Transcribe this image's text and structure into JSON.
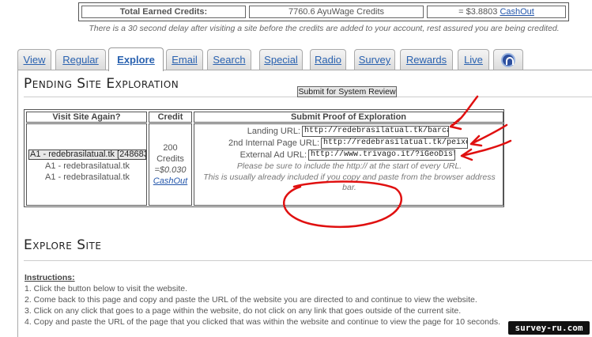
{
  "credits": {
    "label": "Total Earned Credits:",
    "amount": "7760.6 AyuWage Credits",
    "cash_prefix": "= $3.8803 ",
    "cashout_link": "CashOut"
  },
  "delay_note": "There is a 30 second delay after visiting a site before the credits are added to your account, rest assured you are being credited.",
  "tabs": [
    {
      "label": "View"
    },
    {
      "label": "Regular"
    },
    {
      "label": "Explore",
      "active": true
    },
    {
      "label": "Email"
    },
    {
      "label": "Search"
    },
    {
      "label": "Special"
    },
    {
      "label": "Radio"
    },
    {
      "label": "Survey"
    },
    {
      "label": "Rewards"
    },
    {
      "label": "Live"
    },
    {
      "label": "",
      "icon": "faq-icon"
    }
  ],
  "pending": {
    "title": "Pending Site Exploration",
    "headers": {
      "visit": "Visit Site Again?",
      "credit": "Credit",
      "proof": "Submit Proof of Exploration"
    },
    "visit_options": {
      "selected": "A1 - redebrasilatual.tk [248683]",
      "items": [
        "A1 - redebrasilatual.tk",
        "A1 - redebrasilatual.tk"
      ]
    },
    "credit": {
      "amount": "200",
      "unit": "Credits",
      "value": "=$0.030",
      "cashout_link": "CashOut"
    },
    "fields": {
      "landing_label": "Landing URL:",
      "landing_value": "http://redebrasilatual.tk/barca-de-berim",
      "internal_label": "2nd Internal Page URL:",
      "internal_value": "http://redebrasilatual.tk/peixe-na-folha",
      "external_label": "External Ad URL:",
      "external_value": "http://www.trivago.it/?iGeoDistanceItem"
    },
    "note1": "Please be sure to include the http:// at the start of every URL.",
    "note2": "This is usually already included if you copy and paste from the browser address bar.",
    "submit_label": "Submit for System Review"
  },
  "explore": {
    "title": "Explore Site",
    "instructions_title": "Instructions:",
    "steps": [
      "1. Click the button below to visit the website.",
      "2. Come back to this page and copy and paste the URL of the website you are directed to and continue to view the website.",
      "3. Click on any click that goes to a page within the website,    do not click on any link that goes outside of the current site.",
      "4. Copy and paste the URL of the page that you clicked that was within the website and continue to view the page for 10 seconds."
    ]
  },
  "watermark": "survey-ru.com",
  "annotation_color": "#e01010"
}
